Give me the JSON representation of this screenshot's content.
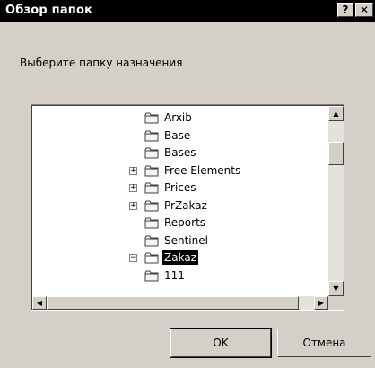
{
  "window": {
    "title": "Обзор папок",
    "help_label": "?",
    "close_label": "✕"
  },
  "prompt": "Выберите папку назначения",
  "tree": {
    "items": [
      {
        "label": "Arxib",
        "expander": ""
      },
      {
        "label": "Base",
        "expander": ""
      },
      {
        "label": "Bases",
        "expander": ""
      },
      {
        "label": "Free Elements",
        "expander": "+"
      },
      {
        "label": "Prices",
        "expander": "+"
      },
      {
        "label": "PrZakaz",
        "expander": "+"
      },
      {
        "label": "Reports",
        "expander": ""
      },
      {
        "label": "Sentinel",
        "expander": ""
      },
      {
        "label": "Zakaz",
        "expander": "−",
        "selected": true
      },
      {
        "label": "111",
        "expander": ""
      }
    ]
  },
  "scroll": {
    "up": "▲",
    "down": "▼",
    "left": "◀",
    "right": "▶"
  },
  "buttons": {
    "ok": "OK",
    "cancel": "Отмена"
  },
  "colors": {
    "dialog_bg": "#d4d0c8",
    "titlebar_bg": "#000000",
    "selection_bg": "#000000"
  }
}
